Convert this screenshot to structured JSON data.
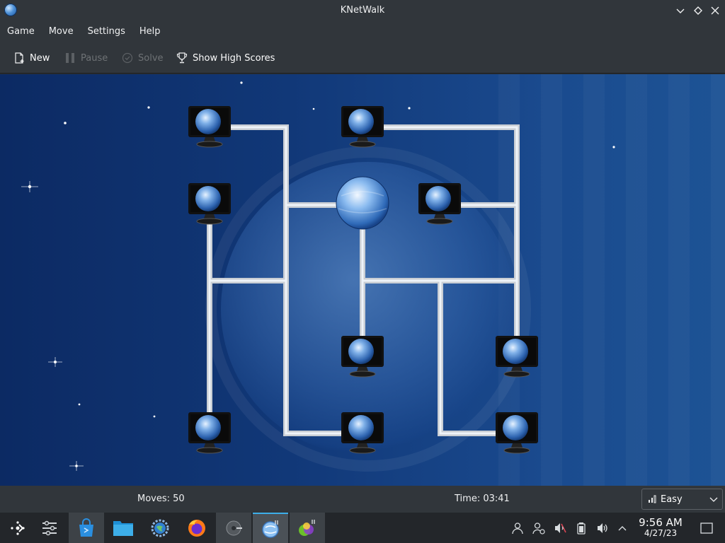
{
  "window": {
    "title": "KNetWalk"
  },
  "menu": [
    "Game",
    "Move",
    "Settings",
    "Help"
  ],
  "toolbar": {
    "new_label": "New",
    "pause_label": "Pause",
    "solve_label": "Solve",
    "highscores_label": "Show High Scores"
  },
  "status": {
    "moves": "Moves: 50",
    "time": "Time: 03:41",
    "difficulty": "Easy"
  },
  "taskbar": {
    "clock_time": "9:56 AM",
    "clock_date": "4/27/23"
  },
  "colors": {
    "chrome": "#31363b",
    "accent": "#3daee9",
    "board_blue": "#113878"
  }
}
